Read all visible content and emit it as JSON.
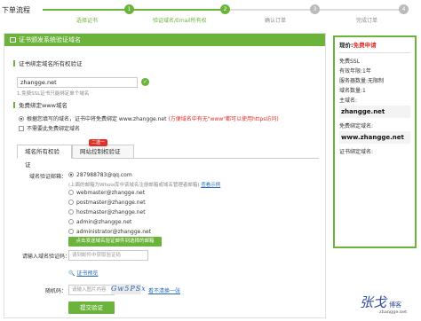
{
  "steps": {
    "title": "下单流程",
    "items": [
      {
        "num": "1",
        "label": "选择证书"
      },
      {
        "num": "2",
        "label": "验证域名/Email所有权"
      },
      {
        "num": "3",
        "label": "确认订单"
      },
      {
        "num": "4",
        "label": "完成订单"
      }
    ]
  },
  "main": {
    "header": "证书颁发系统验证域名",
    "domain_section": "证书绑定域名所有权验证",
    "domain_value": "zhangge.net",
    "domain_hint": "1.免费SSL证书只能绑定单个域名",
    "bind_section": "免费绑定www域名",
    "bind_yes_text": "根据您填写的域名，证书中将免费绑定 www.zhangge.net",
    "bind_yes_note": "(方便域名中有无\"www\"都可以使用https访问)",
    "bind_no_text": "不需要此免费绑定域名",
    "tab_domain": "域名所有权验证",
    "tab_site": "网站控制权验证",
    "tab_badge": "二选一",
    "email_label": "域名验证邮箱：",
    "emails": [
      "287988783@qq.com",
      "webmaster@zhangge.net",
      "postmaster@zhangge.net",
      "hostmaster@zhangge.net",
      "admin@zhangge.net",
      "administrator@zhangge.net"
    ],
    "whois_note": "(上面的邮箱为Whois库中该域名注册邮箱或域名管理者邮箱)",
    "whois_link": "查看示例",
    "send_button": "点击发送域名验证邮件到选择的邮箱",
    "code_label": "请输入域名验证码：",
    "code_placeholder": "请到邮件中获取验证码",
    "preview_link": "证书预览",
    "captcha_label": "随机码：",
    "captcha_placeholder": "请输入图片内容",
    "captcha_text": "Gw5PSx",
    "captcha_refresh": "看不清换一张",
    "submit": "提交验证"
  },
  "side": {
    "title_prefix": "现价:",
    "title_price": "免费申请",
    "product": "免费SSL",
    "validity": "有效年限:1年",
    "servers": "服务器数量:无限制",
    "domains_count": "域名数量:1",
    "main_domain_label": "主域名:",
    "main_domain": "zhangge.net",
    "free_domain_label": "免费绑定域名:",
    "free_domain": "www.zhangge.net",
    "cert_domains_label": "证书绑定域名:"
  },
  "watermark": {
    "signature": "张戈",
    "badge": "博客",
    "url": "zhangge.net"
  }
}
